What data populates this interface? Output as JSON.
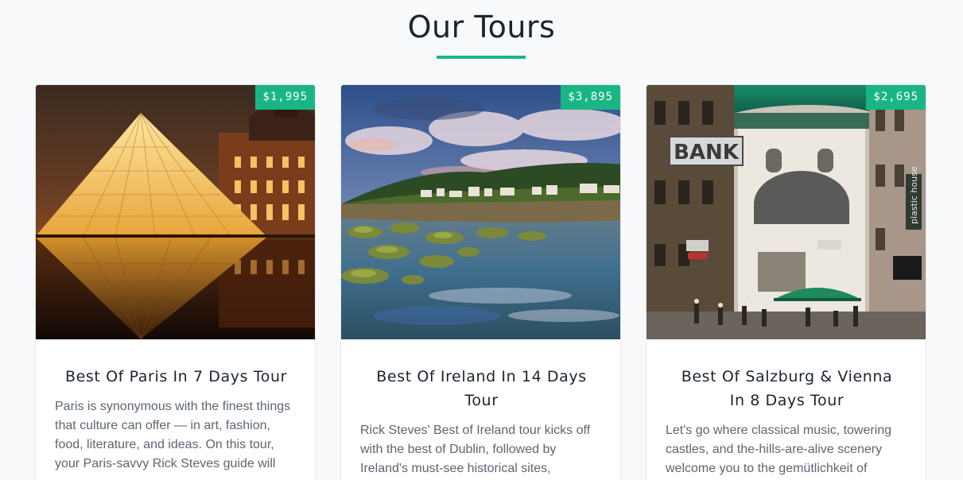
{
  "section": {
    "title": "Our Tours"
  },
  "tours": [
    {
      "price": "$1,995",
      "title": "Best Of Paris In 7 Days Tour",
      "description": "Paris is synonymous with the finest things that culture can offer — in art, fashion, food, literature, and ideas. On this tour, your Paris-savvy Rick Steves guide will",
      "image": "louvre-pyramid-night-photo"
    },
    {
      "price": "$3,895",
      "title": "Best Of Ireland In 14 Days Tour",
      "description": "Rick Steves' Best of Ireland tour kicks off with the best of Dublin, followed by Ireland's must-see historical sites,",
      "image": "irish-coast-village-photo"
    },
    {
      "price": "$2,695",
      "title": "Best Of Salzburg & Vienna In 8 Days Tour",
      "description": "Let's go where classical music, towering castles, and the-hills-are-alive scenery welcome you to the gemütlichkeit of",
      "image": "vienna-street-church-photo"
    }
  ],
  "colors": {
    "accent": "#1ab585",
    "background": "#f8f9fa",
    "card": "#ffffff",
    "text_muted": "#5b6670",
    "heading": "#1a2530"
  }
}
